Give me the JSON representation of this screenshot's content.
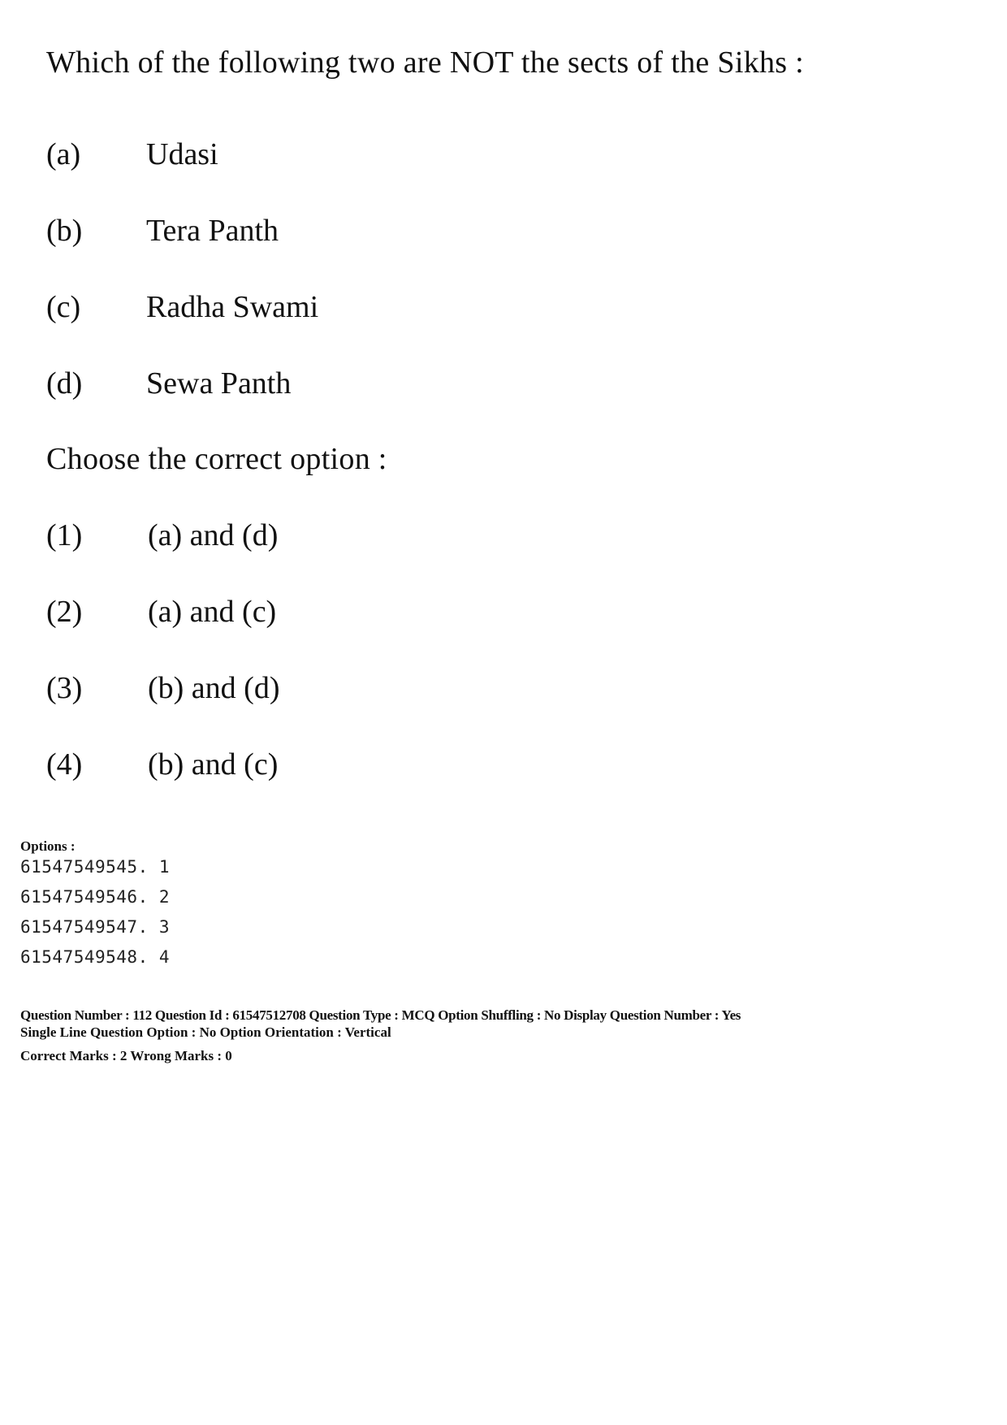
{
  "question": {
    "text": "Which of the following two are NOT the sects of the Sikhs :",
    "items": [
      {
        "label": "(a)",
        "text": "Udasi"
      },
      {
        "label": "(b)",
        "text": "Tera Panth"
      },
      {
        "label": "(c)",
        "text": "Radha Swami"
      },
      {
        "label": "(d)",
        "text": "Sewa Panth"
      }
    ],
    "prompt": "Choose the correct option :",
    "choices": [
      {
        "label": "(1)",
        "text": "(a) and (d)"
      },
      {
        "label": "(2)",
        "text": "(a) and (c)"
      },
      {
        "label": "(3)",
        "text": "(b) and (d)"
      },
      {
        "label": "(4)",
        "text": "(b) and (c)"
      }
    ]
  },
  "options": {
    "heading": "Options :",
    "rows": [
      "61547549545. 1",
      "61547549546. 2",
      "61547549547. 3",
      "61547549548. 4"
    ]
  },
  "meta": {
    "line1": "Question Number : 112  Question Id : 61547512708  Question Type : MCQ  Option Shuffling : No  Display Question Number : Yes",
    "line2": "Single Line Question Option : No  Option Orientation : Vertical",
    "line3": "Correct Marks : 2  Wrong Marks : 0"
  }
}
